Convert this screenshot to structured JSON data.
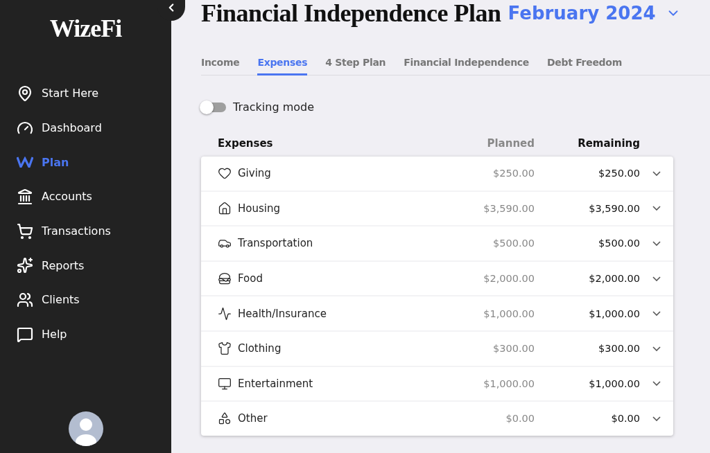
{
  "sidebar": {
    "logo": "WizeFi",
    "items": [
      {
        "label": "Start Here",
        "selected": false
      },
      {
        "label": "Dashboard",
        "selected": false
      },
      {
        "label": "Plan",
        "selected": true
      },
      {
        "label": "Accounts",
        "selected": false
      },
      {
        "label": "Transactions",
        "selected": false
      },
      {
        "label": "Reports",
        "selected": false
      },
      {
        "label": "Clients",
        "selected": false
      },
      {
        "label": "Help",
        "selected": false
      }
    ]
  },
  "header": {
    "title": "Financial Independence Plan",
    "period": "February 2024"
  },
  "tabs": [
    {
      "label": "Income",
      "selected": false
    },
    {
      "label": "Expenses",
      "selected": true
    },
    {
      "label": "4 Step Plan",
      "selected": false
    },
    {
      "label": "Financial Independence",
      "selected": false
    },
    {
      "label": "Debt Freedom",
      "selected": false
    }
  ],
  "tracking_mode": {
    "label": "Tracking mode",
    "on": false
  },
  "table": {
    "columns": [
      "Expenses",
      "Planned",
      "Remaining"
    ],
    "rows": [
      {
        "name": "Giving",
        "planned": "$250.00",
        "remaining": "$250.00"
      },
      {
        "name": "Housing",
        "planned": "$3,590.00",
        "remaining": "$3,590.00"
      },
      {
        "name": "Transportation",
        "planned": "$500.00",
        "remaining": "$500.00"
      },
      {
        "name": "Food",
        "planned": "$2,000.00",
        "remaining": "$2,000.00"
      },
      {
        "name": "Health/Insurance",
        "planned": "$1,000.00",
        "remaining": "$1,000.00"
      },
      {
        "name": "Clothing",
        "planned": "$300.00",
        "remaining": "$300.00"
      },
      {
        "name": "Entertainment",
        "planned": "$1,000.00",
        "remaining": "$1,000.00"
      },
      {
        "name": "Other",
        "planned": "$0.00",
        "remaining": "$0.00"
      }
    ]
  }
}
